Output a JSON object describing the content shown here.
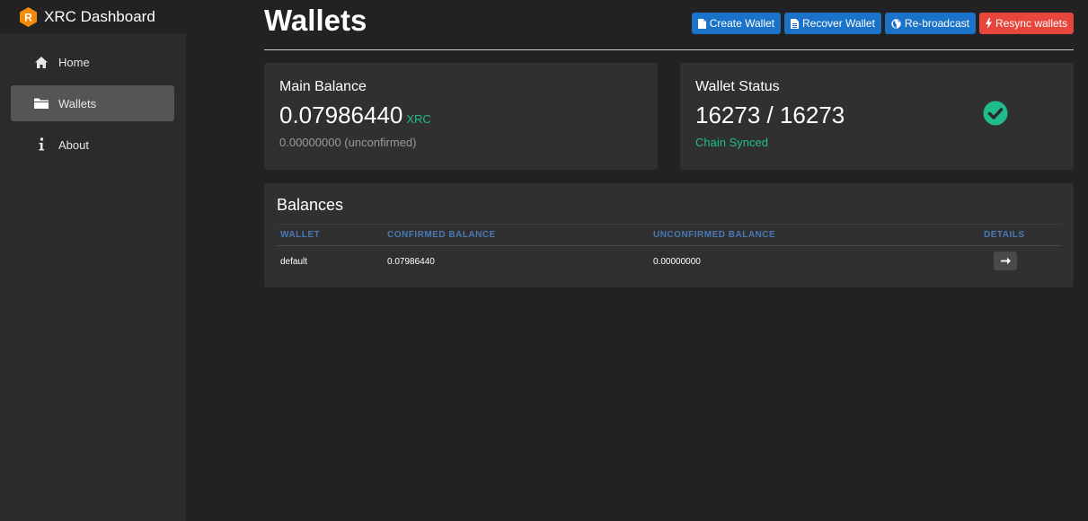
{
  "app": {
    "title": "XRC Dashboard",
    "logo_letter": "R",
    "logo_color": "#f28b0c"
  },
  "sidebar": {
    "items": [
      {
        "label": "Home",
        "icon": "home-icon",
        "active": false
      },
      {
        "label": "Wallets",
        "icon": "folder-icon",
        "active": true
      },
      {
        "label": "About",
        "icon": "info-icon",
        "active": false
      }
    ]
  },
  "page": {
    "title": "Wallets"
  },
  "toolbar": {
    "create_label": "Create Wallet",
    "recover_label": "Recover Wallet",
    "rebroadcast_label": "Re-broadcast",
    "resync_label": "Resync wallets"
  },
  "main_balance": {
    "title": "Main Balance",
    "value": "0.07986440",
    "unit": "XRC",
    "unconfirmed": "0.00000000 (unconfirmed)"
  },
  "wallet_status": {
    "title": "Wallet Status",
    "blocks": "16273 / 16273",
    "status": "Chain Synced",
    "status_icon": "check-circle-icon"
  },
  "balances": {
    "title": "Balances",
    "columns": [
      "WALLET",
      "CONFIRMED BALANCE",
      "UNCONFIRMED BALANCE",
      "DETAILS"
    ],
    "rows": [
      {
        "wallet": "default",
        "confirmed": "0.07986440",
        "unconfirmed": "0.00000000",
        "details_icon": "arrow-right-icon"
      }
    ]
  },
  "colors": {
    "accent_blue": "#1a73c9",
    "danger_red": "#e8453c",
    "success_green": "#1fbd8c",
    "header_blue": "#4a78b5"
  }
}
